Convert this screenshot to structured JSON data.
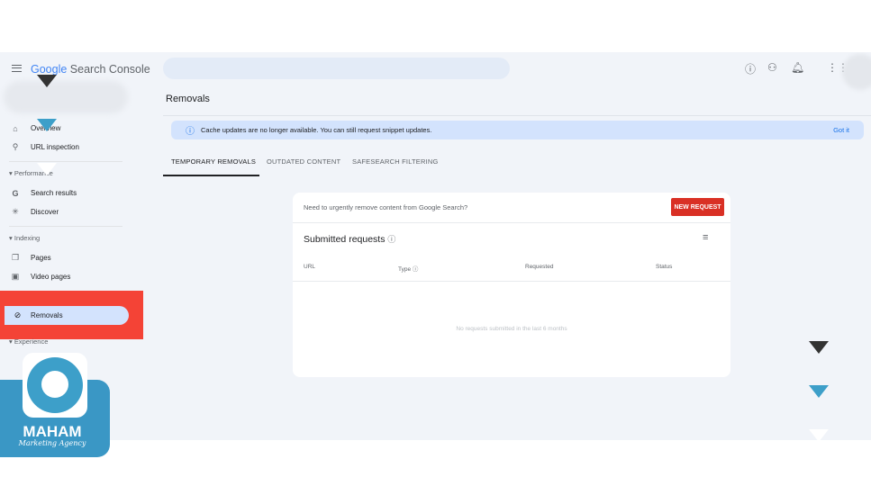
{
  "header": {
    "brand_google": "Google",
    "brand_product": "Search Console",
    "icons": [
      "help-icon",
      "manage-users-icon",
      "notifications-icon",
      "apps-icon"
    ]
  },
  "sidebar": {
    "items": [
      {
        "label": "Overview",
        "icon": "home-icon"
      },
      {
        "label": "URL inspection",
        "icon": "search-icon"
      }
    ],
    "performance": {
      "label": "Performance",
      "items": [
        {
          "label": "Search results",
          "icon": "google-g-icon"
        },
        {
          "label": "Discover",
          "icon": "asterisk-icon"
        }
      ]
    },
    "indexing": {
      "label": "Indexing",
      "items": [
        {
          "label": "Pages",
          "icon": "pages-icon"
        },
        {
          "label": "Video pages",
          "icon": "video-pages-icon"
        }
      ]
    },
    "removals": {
      "label": "Removals",
      "icon": "eye-off-icon"
    },
    "experience": {
      "label": "Experience"
    },
    "highlight_color": "#f44336"
  },
  "main": {
    "title": "Removals",
    "banner": {
      "text": "Cache updates are no longer available. You can still request snippet updates.",
      "action": "Got it"
    },
    "tabs": [
      {
        "label": "TEMPORARY REMOVALS",
        "active": true
      },
      {
        "label": "OUTDATED CONTENT"
      },
      {
        "label": "SAFESEARCH FILTERING"
      }
    ],
    "card": {
      "prompt": "Need to urgently remove content from Google Search?",
      "new_request": "NEW REQUEST",
      "heading": "Submitted requests",
      "columns": [
        "URL",
        "Type",
        "Requested",
        "Status"
      ],
      "empty": "No requests submitted in the last 6 months"
    }
  },
  "watermark": {
    "name": "MAHAM",
    "tagline": "Marketing Agency",
    "color": "#3d9fc9"
  }
}
